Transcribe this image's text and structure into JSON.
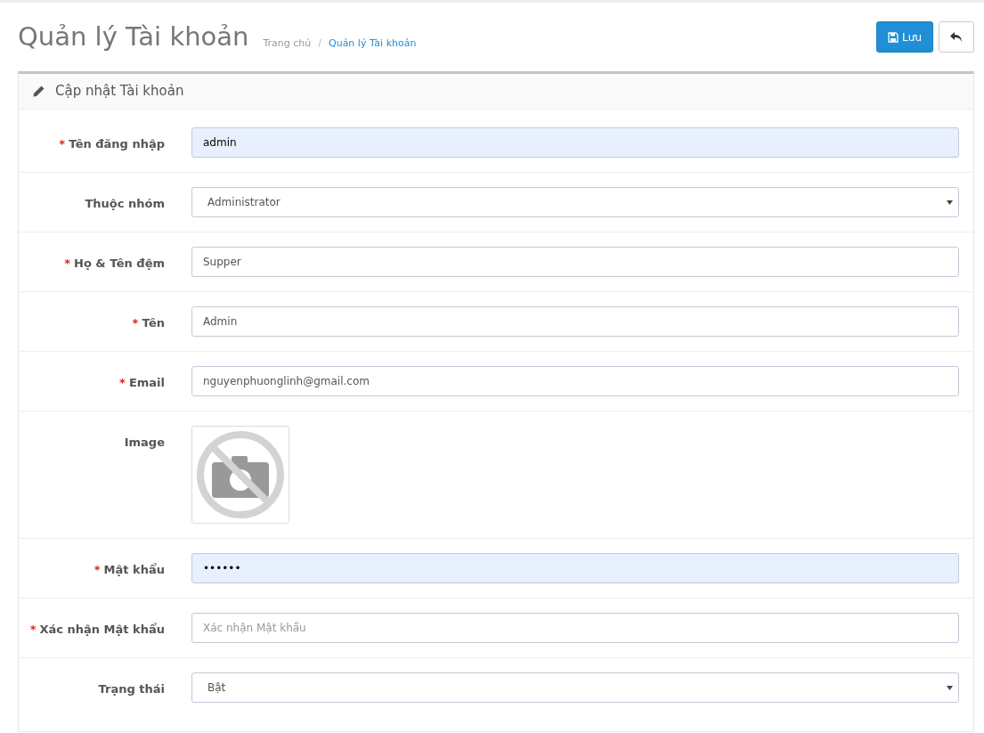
{
  "page_title": "Quản lý Tài khoản",
  "breadcrumb": [
    {
      "label": "Trang chủ",
      "current": false
    },
    {
      "separator": "/",
      "label": "Quản lý Tài khoản",
      "current": true
    }
  ],
  "actions": {
    "save": "Lưu"
  },
  "panel": {
    "title": "Cập nhật Tài khoản",
    "fields": [
      {
        "kind": "text",
        "required_mark": "*",
        "label": "Tên đăng nhập",
        "value": "admin",
        "autofilled": true
      },
      {
        "kind": "select",
        "label": "Thuộc nhóm",
        "value": "Administrator"
      },
      {
        "kind": "text",
        "required_mark": "*",
        "label": "Họ & Tên đệm",
        "value": "Supper",
        "autofilled": false
      },
      {
        "kind": "text",
        "required_mark": "*",
        "label": "Tên",
        "value": "Admin",
        "autofilled": false
      },
      {
        "kind": "text",
        "required_mark": "*",
        "label": "Email",
        "value": "nguyenphuonglinh@gmail.com",
        "autofilled": false
      },
      {
        "kind": "image",
        "label": "Image"
      },
      {
        "kind": "text",
        "required_mark": "*",
        "label": "Mật khẩu",
        "value": "••••••",
        "autofilled": true
      },
      {
        "kind": "text",
        "required_mark": "*",
        "label": "Xác nhận Mật khẩu",
        "placeholder": "Xác nhận Mật khẩu",
        "autofilled": false
      },
      {
        "kind": "select",
        "label": "Trạng thái",
        "value": "Bật"
      }
    ]
  }
}
